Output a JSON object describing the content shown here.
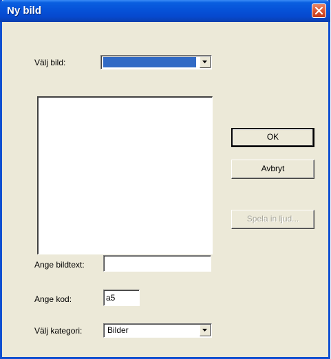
{
  "window": {
    "title": "Ny bild"
  },
  "image_select": {
    "label": "Välj bild:",
    "value": ""
  },
  "buttons": {
    "ok": "OK",
    "cancel": "Avbryt",
    "record": "Spela in ljud..."
  },
  "caption": {
    "label": "Ange bildtext:",
    "value": ""
  },
  "code": {
    "label": "Ange kod:",
    "value": "a5"
  },
  "category": {
    "label": "Välj kategori:",
    "value": "Bilder"
  },
  "icons": {
    "close": "close-icon",
    "dropdown": "dropdown-arrow-icon"
  },
  "colors": {
    "titlebar": "#0652d8",
    "close": "#d9522f",
    "selection": "#316ac5",
    "dialog": "#ece9d8"
  }
}
